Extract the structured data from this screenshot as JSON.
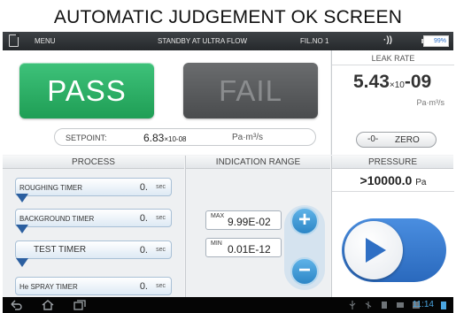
{
  "caption": "AUTOMATIC JUDGEMENT OK SCREEN",
  "topbar": {
    "menu_label": "MENU",
    "status": "STANDBY AT ULTRA FLOW",
    "filament": "FIL.NO 1",
    "signal": "·))",
    "battery": "99%"
  },
  "judgement": {
    "pass_label": "PASS",
    "fail_label": "FAIL",
    "result": "PASS",
    "setpoint_label": "SETPOINT:",
    "setpoint_mantissa": "6.83",
    "setpoint_exp": "×10-08",
    "setpoint_unit": "Pa·m³/s"
  },
  "leak_rate": {
    "title": "LEAK RATE",
    "mantissa": "5.43",
    "times": "×10",
    "exponent": "-09",
    "unit": "Pa·m³/s",
    "zero_icon": "-0-",
    "zero_label": "ZERO"
  },
  "process": {
    "title": "PROCESS",
    "timers": [
      {
        "label": "ROUGHING TIMER",
        "value": "0.",
        "unit": "sec"
      },
      {
        "label": "BACKGROUND TIMER",
        "value": "0.",
        "unit": "sec"
      },
      {
        "label": "TEST TIMER",
        "value": "0.",
        "unit": "sec"
      },
      {
        "label": "He SPRAY TIMER",
        "value": "0.",
        "unit": "sec"
      }
    ]
  },
  "indication_range": {
    "title": "INDICATION RANGE",
    "max_tag": "MAX",
    "max_value": "9.99E-02",
    "min_tag": "MIN",
    "min_value": "0.01E-12",
    "plus_label": "+",
    "minus_label": "−"
  },
  "pressure": {
    "title": "PRESSURE",
    "value": ">10000.0",
    "unit": "Pa"
  },
  "navbar": {
    "time": "11:14"
  },
  "colors": {
    "pass": "#2ab066",
    "fail": "#5a5c5e",
    "accent_blue": "#2c7fd0",
    "topbar": "#2e3134"
  },
  "icons": {
    "menu": "document-icon",
    "play": "play-icon",
    "back": "back-icon",
    "home": "home-icon",
    "recent": "recent-apps-icon"
  }
}
